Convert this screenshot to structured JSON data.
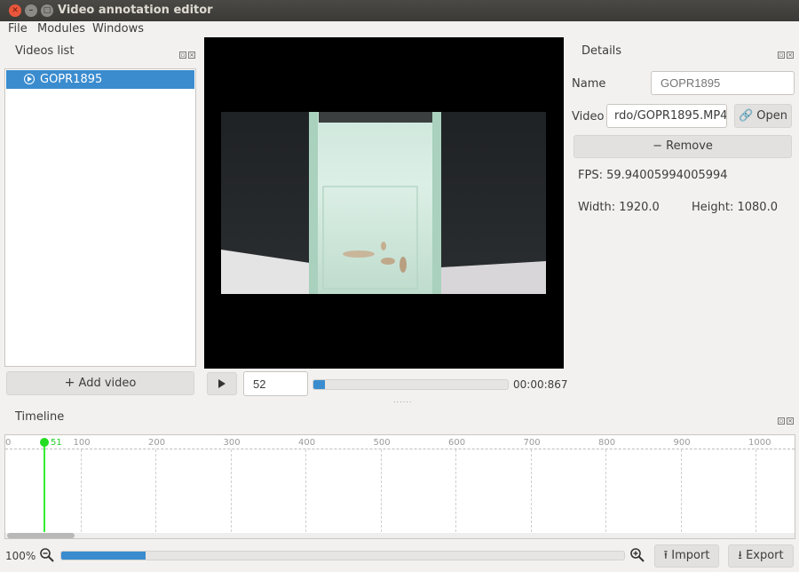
{
  "window": {
    "title": "Video annotation editor"
  },
  "menu": [
    "File",
    "Modules",
    "Windows"
  ],
  "videos_panel": {
    "title": "Videos list",
    "items": [
      {
        "label": "GOPR1895",
        "selected": true
      }
    ],
    "add_button": "Add video"
  },
  "player": {
    "play_icon": "play-icon",
    "frame_value": "52",
    "time": "00:00:867",
    "progress": 0.06
  },
  "details": {
    "title": "Details",
    "name_label": "Name",
    "name_placeholder": "GOPR1895",
    "video_label": "Video",
    "video_path": "rdo/GOPR1895.MP4",
    "open_button": "Open",
    "remove_button": "Remove",
    "fps": "FPS: 59.94005994005994",
    "width": "Width: 1920.0",
    "height": "Height: 1080.0"
  },
  "timeline": {
    "title": "Timeline",
    "cursor_frame": "51",
    "ticks": [
      "0",
      "100",
      "200",
      "300",
      "400",
      "500",
      "600",
      "700",
      "800",
      "900",
      "1000"
    ],
    "zoom": "100%",
    "zoom_level": 0.15,
    "import_button": "Import",
    "export_button": "Export"
  },
  "colors": {
    "accent": "#3a8ccf",
    "cursor": "#22dd22",
    "titlebar": "#3b3a36"
  }
}
